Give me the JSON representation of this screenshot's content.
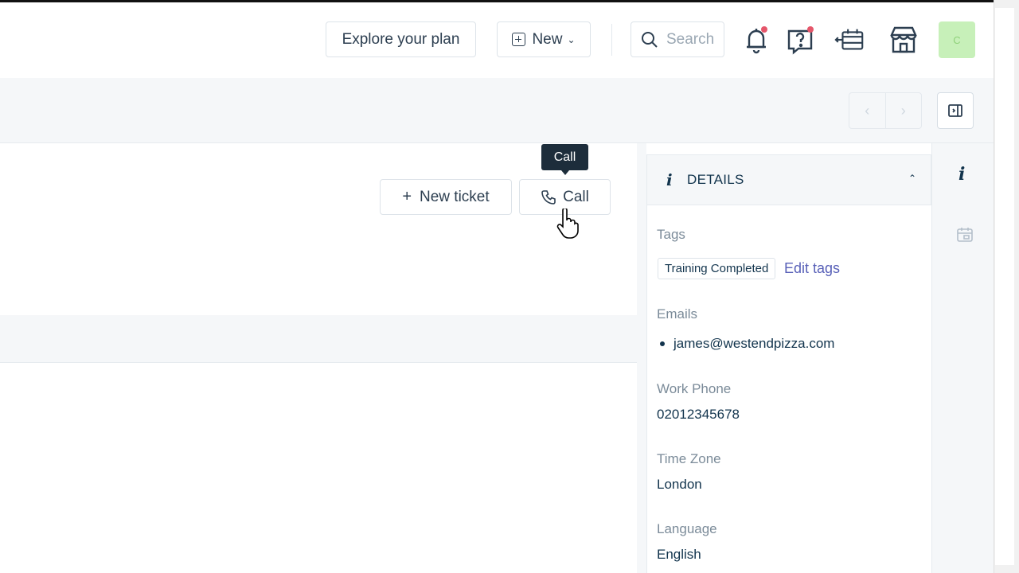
{
  "header": {
    "explore_label": "Explore your plan",
    "new_label": "New",
    "search_placeholder": "Search",
    "avatar_initial": "C"
  },
  "icons": {
    "notifications": "bell-icon",
    "help": "help-icon",
    "release_notes": "release-notes-icon",
    "marketplace": "store-icon"
  },
  "colors": {
    "notification_dot": "#e5566a",
    "avatar_bg": "#c7f0b9",
    "link": "#5961b8",
    "tooltip_bg": "#1d2d3b"
  },
  "actions": {
    "new_ticket_label": "New ticket",
    "call_label": "Call",
    "call_tooltip": "Call"
  },
  "details": {
    "title": "DETAILS",
    "tags_label": "Tags",
    "tags": [
      "Training Completed"
    ],
    "edit_tags_label": "Edit tags",
    "emails_label": "Emails",
    "emails": [
      "james@westendpizza.com"
    ],
    "work_phone_label": "Work Phone",
    "work_phone": "02012345678",
    "time_zone_label": "Time Zone",
    "time_zone": "London",
    "language_label": "Language",
    "language": "English"
  }
}
